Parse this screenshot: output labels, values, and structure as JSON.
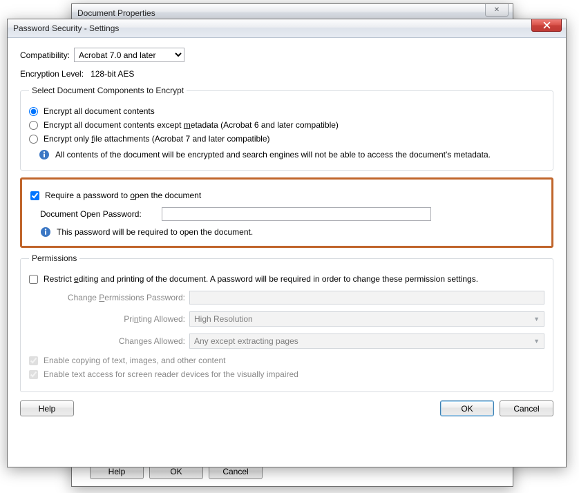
{
  "parent": {
    "title": "Document Properties",
    "help": "Help",
    "ok": "OK",
    "cancel": "Cancel"
  },
  "dialog": {
    "title": "Password Security - Settings",
    "compat_label": "Compatibility:",
    "compat_value": "Acrobat 7.0 and later",
    "enc_label": "Encryption  Level:",
    "enc_value": "128-bit AES",
    "group_components": "Select Document Components to Encrypt",
    "opt_all": "Encrypt all document contents",
    "opt_meta_pre": "Encrypt all document contents except ",
    "opt_meta_u": "m",
    "opt_meta_post": "etadata (Acrobat 6 and later compatible)",
    "opt_file_pre": "Encrypt only ",
    "opt_file_u": "f",
    "opt_file_post": "ile attachments (Acrobat 7 and later compatible)",
    "info_components": "All contents of the document will be encrypted and search engines will not be able to access the document's metadata.",
    "req_open_pre": "Require a password to ",
    "req_open_u": "o",
    "req_open_post": "pen the document",
    "open_pwd_label": "Document Open Password:",
    "info_open": "This password will be required to open the document.",
    "group_permissions": "Permissions",
    "restrict_pre": "Restrict ",
    "restrict_u": "e",
    "restrict_post": "diting and printing of the document. A password will be required in order to change these permission settings.",
    "change_pwd_pre": "Change ",
    "change_pwd_u": "P",
    "change_pwd_post": "ermissions Password:",
    "print_pre": "Pri",
    "print_u": "n",
    "print_post": "ting Allowed:",
    "print_value": "High Resolution",
    "changes_pre": "Chan",
    "changes_u": "g",
    "changes_post": "es Allowed:",
    "changes_value": "Any except extracting pages",
    "enable_copy": "Enable copying of text, images, and other content",
    "enable_access": "Enable text access for screen reader devices for the visually impaired",
    "help": "Help",
    "ok": "OK",
    "cancel": "Cancel"
  }
}
